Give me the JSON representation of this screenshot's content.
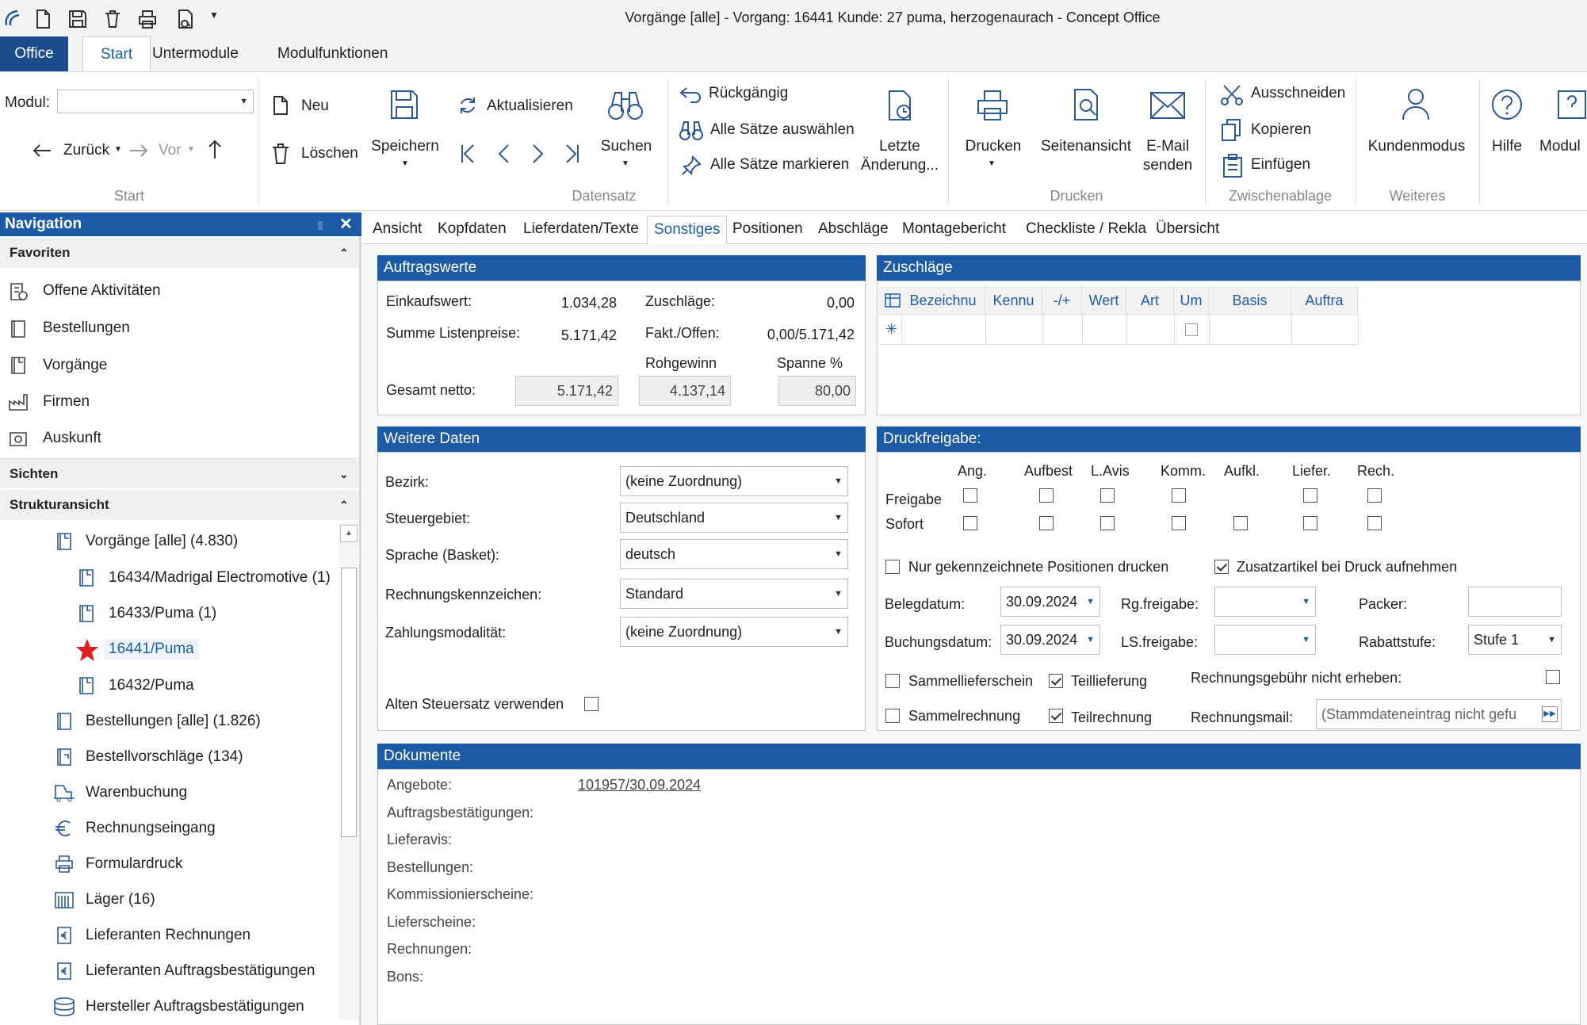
{
  "window": {
    "title": "Vorgänge [alle] - Vorgang: 16441 Kunde: 27 puma, herzogenaurach - Concept Office"
  },
  "menu": {
    "tabs": [
      "Office",
      "Start",
      "Untermodule",
      "Modulfunktionen"
    ]
  },
  "ribbon": {
    "modul_label": "Modul:",
    "modul_value": "",
    "back": "Zurück",
    "forward": "Vor",
    "new": "Neu",
    "delete": "Löschen",
    "save": "Speichern",
    "refresh": "Aktualisieren",
    "search": "Suchen",
    "undo": "Rückgängig",
    "select_all": "Alle Sätze auswählen",
    "mark_all": "Alle Sätze markieren",
    "last_change": "Letzte Änderung...",
    "print": "Drucken",
    "preview": "Seitenansicht",
    "email": "E-Mail senden",
    "cut": "Ausschneiden",
    "copy": "Kopieren",
    "paste": "Einfügen",
    "customer_mode": "Kundenmodus",
    "help": "Hilfe",
    "module": "Modul",
    "groups": {
      "start": "Start",
      "datensatz": "Datensatz",
      "drucken": "Drucken",
      "clipboard": "Zwischenablage",
      "weiteres": "Weiteres"
    }
  },
  "navigation": {
    "title": "Navigation",
    "favorites_label": "Favoriten",
    "favorites": [
      "Offene Aktivitäten",
      "Bestellungen",
      "Vorgänge",
      "Firmen",
      "Auskunft"
    ],
    "views_label": "Sichten",
    "tree_label": "Strukturansicht",
    "tree": [
      "Vorgänge [alle] (4.830)",
      "16434/Madrigal Electromotive (1)",
      "16433/Puma (1)",
      "16441/Puma",
      "16432/Puma",
      "Bestellungen [alle] (1.826)",
      "Bestellvorschläge (134)",
      "Warenbuchung",
      "Rechnungseingang",
      "Formulardruck",
      "Läger (16)",
      "Lieferanten Rechnungen",
      "Lieferanten Auftragsbestätigungen",
      "Hersteller Auftragsbestätigungen"
    ]
  },
  "content_tabs": [
    "Ansicht",
    "Kopfdaten",
    "Lieferdaten/Texte",
    "Sonstiges",
    "Positionen",
    "Abschläge",
    "Montagebericht",
    "Checkliste / Rekla",
    "Übersicht"
  ],
  "auftragswerte": {
    "title": "Auftragswerte",
    "einkaufswert_label": "Einkaufswert:",
    "einkaufswert": "1.034,28",
    "zuschlaege_label": "Zuschläge:",
    "zuschlaege": "0,00",
    "listenpreise_label": "Summe Listenpreise:",
    "listenpreise": "5.171,42",
    "fakt_label": "Fakt./Offen:",
    "fakt": "0,00/5.171,42",
    "rohgewinn_label": "Rohgewinn",
    "spanne_label": "Spanne %",
    "gesamt_label": "Gesamt netto:",
    "gesamt": "5.171,42",
    "rohgewinn": "4.137,14",
    "spanne": "80,00"
  },
  "zuschlaege_grid": {
    "title": "Zuschläge",
    "columns": [
      "Bezeichnu",
      "Kennu",
      "-/+",
      "Wert",
      "Art",
      "Um",
      "Basis",
      "Auftra"
    ]
  },
  "weitere": {
    "title": "Weitere Daten",
    "bezirk_label": "Bezirk:",
    "bezirk": "(keine Zuordnung)",
    "steuer_label": "Steuergebiet:",
    "steuer": "Deutschland",
    "sprache_label": "Sprache (Basket):",
    "sprache": "deutsch",
    "rkz_label": "Rechnungskennzeichen:",
    "rkz": "Standard",
    "zahl_label": "Zahlungsmodalität:",
    "zahl": "(keine Zuordnung)",
    "alt_label": "Alten Steuersatz verwenden"
  },
  "druck": {
    "title": "Druckfreigabe:",
    "cols": [
      "Ang.",
      "Aufbest",
      "L.Avis",
      "Komm.",
      "Aufkl.",
      "Liefer.",
      "Rech."
    ],
    "freigabe_label": "Freigabe",
    "sofort_label": "Sofort",
    "nur_label": "Nur gekennzeichnete Positionen drucken",
    "zusatz_label": "Zusatzartikel bei Druck aufnehmen",
    "belegdatum_label": "Belegdatum:",
    "belegdatum": "30.09.2024",
    "rgfreigabe_label": "Rg.freigabe:",
    "packer_label": "Packer:",
    "buchung_label": "Buchungsdatum:",
    "buchung": "30.09.2024",
    "lsfreigabe_label": "LS.freigabe:",
    "rabatt_label": "Rabattstufe:",
    "rabatt": "Stufe 1",
    "sammells_label": "Sammellieferschein",
    "teillief_label": "Teillieferung",
    "gebuehr_label": "Rechnungsgebühr nicht erheben:",
    "sammelrg_label": "Sammelrechnung",
    "teilrg_label": "Teilrechnung",
    "mail_label": "Rechnungsmail:",
    "mail": "(Stammdateneintrag nicht gefu"
  },
  "dokumente": {
    "title": "Dokumente",
    "rows": [
      "Angebote:",
      "Auftragsbestätigungen:",
      "Lieferavis:",
      "Bestellungen:",
      "Kommissionierscheine:",
      "Lieferscheine:",
      "Rechnungen:",
      "Bons:"
    ],
    "angebot_link": "101957/30.09.2024"
  },
  "colors": {
    "accent": "#1c5aa5",
    "office": "#1c4c8c",
    "star": "#e02020"
  }
}
